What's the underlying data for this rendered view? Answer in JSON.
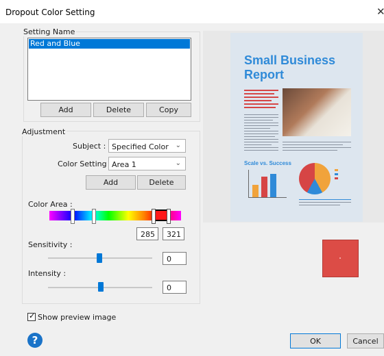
{
  "window": {
    "title": "Dropout Color Setting",
    "close": "✕"
  },
  "setting_name": {
    "label": "Setting Name",
    "items": [
      "Red and Blue"
    ],
    "buttons": {
      "add": "Add",
      "delete": "Delete",
      "copy": "Copy"
    }
  },
  "adjustment": {
    "label": "Adjustment",
    "subject_label": "Subject :",
    "subject_value": "Specified Color",
    "color_setting_label": "Color Setting :",
    "color_setting_value": "Area 1",
    "buttons": {
      "add": "Add",
      "delete": "Delete"
    },
    "color_area_label": "Color Area :",
    "color_area_from": "285",
    "color_area_to": "321",
    "sensitivity_label": "Sensitivity :",
    "sensitivity_value": "0",
    "intensity_label": "Intensity :",
    "intensity_value": "0"
  },
  "preview": {
    "doc_title_line1": "Small Business",
    "doc_title_line2": "Report",
    "chart_heading": "Scale vs. Success",
    "swatch_color": "#dc4c46"
  },
  "footer": {
    "show_preview_label": "Show preview image",
    "show_preview_checked": true,
    "ok": "OK",
    "cancel": "Cancel"
  },
  "colors": {
    "accent": "#0078d7",
    "doc_blue": "#2f8ad8",
    "doc_red": "#d64545"
  }
}
